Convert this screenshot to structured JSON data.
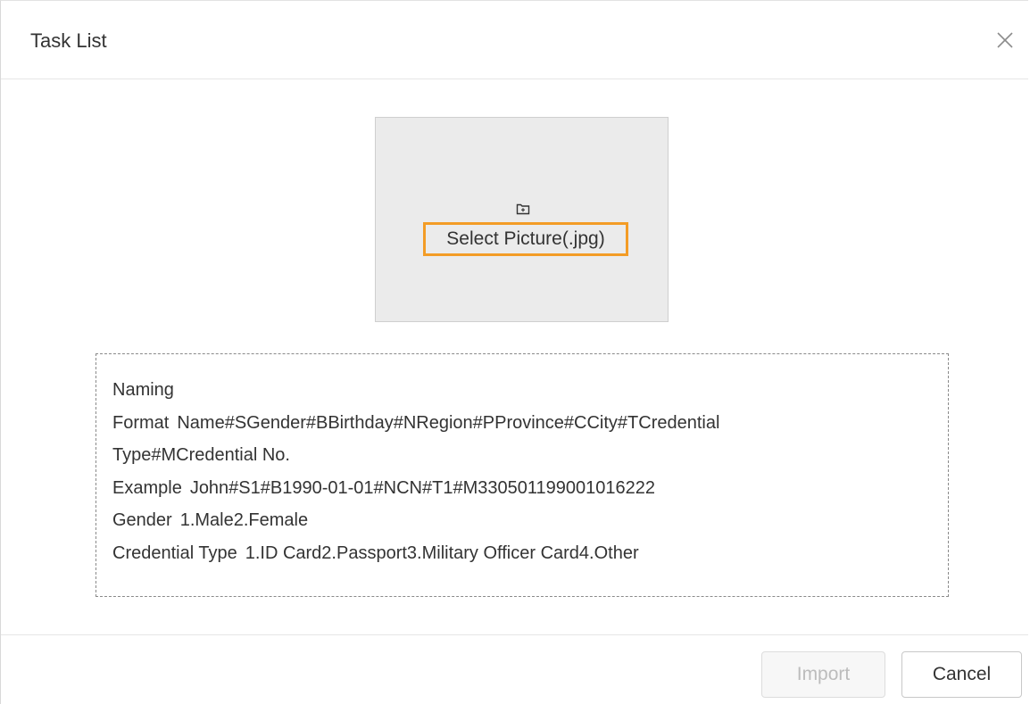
{
  "dialog": {
    "title": "Task List",
    "close_icon": "close-icon"
  },
  "picture_selector": {
    "icon": "folder-icon",
    "label": "Select Picture(.jpg)",
    "highlight_color": "#f39c26"
  },
  "naming": {
    "heading": "Naming",
    "format_label": "Format",
    "format_value_line1": "Name#SGender#BBirthday#NRegion#PProvince#CCity#TCredential",
    "format_value_line2": "Type#MCredential No.",
    "example_label": "Example",
    "example_value": "John#S1#B1990-01-01#NCN#T1#M330501199001016222",
    "gender_label": "Gender",
    "gender_value": "1.Male2.Female",
    "credential_label": "Credential Type",
    "credential_value": "1.ID Card2.Passport3.Military Officer Card4.Other"
  },
  "footer": {
    "import_label": "Import",
    "import_disabled": true,
    "cancel_label": "Cancel"
  }
}
